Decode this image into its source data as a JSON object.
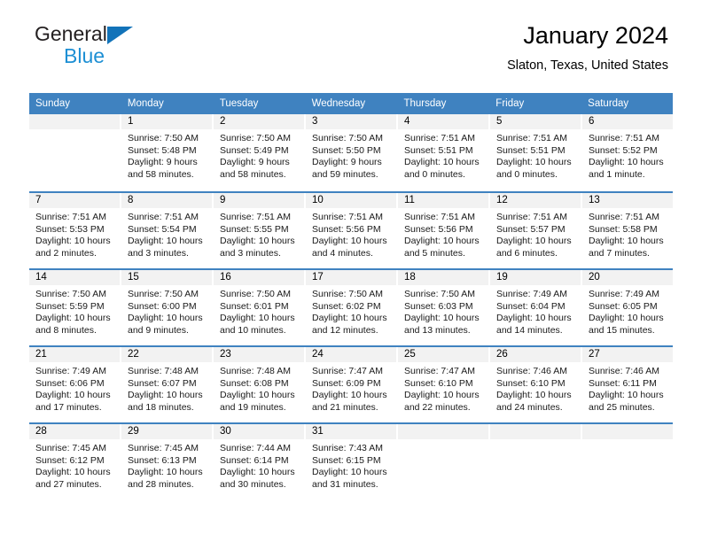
{
  "brand": {
    "name_dark": "General",
    "name_light": "Blue",
    "triangle_color": "#1273b9",
    "light_color": "#1d8fd4"
  },
  "header": {
    "title": "January 2024",
    "subtitle": "Slaton, Texas, United States"
  },
  "theme": {
    "header_row_bg": "#3f82c0",
    "day_number_bg": "#f2f2f2",
    "text_color": "#000000"
  },
  "calendar": {
    "weekday_headers": [
      "Sunday",
      "Monday",
      "Tuesday",
      "Wednesday",
      "Thursday",
      "Friday",
      "Saturday"
    ],
    "weeks": [
      [
        {
          "day": "",
          "lines": []
        },
        {
          "day": "1",
          "lines": [
            "Sunrise: 7:50 AM",
            "Sunset: 5:48 PM",
            "Daylight: 9 hours",
            "and 58 minutes."
          ]
        },
        {
          "day": "2",
          "lines": [
            "Sunrise: 7:50 AM",
            "Sunset: 5:49 PM",
            "Daylight: 9 hours",
            "and 58 minutes."
          ]
        },
        {
          "day": "3",
          "lines": [
            "Sunrise: 7:50 AM",
            "Sunset: 5:50 PM",
            "Daylight: 9 hours",
            "and 59 minutes."
          ]
        },
        {
          "day": "4",
          "lines": [
            "Sunrise: 7:51 AM",
            "Sunset: 5:51 PM",
            "Daylight: 10 hours",
            "and 0 minutes."
          ]
        },
        {
          "day": "5",
          "lines": [
            "Sunrise: 7:51 AM",
            "Sunset: 5:51 PM",
            "Daylight: 10 hours",
            "and 0 minutes."
          ]
        },
        {
          "day": "6",
          "lines": [
            "Sunrise: 7:51 AM",
            "Sunset: 5:52 PM",
            "Daylight: 10 hours",
            "and 1 minute."
          ]
        }
      ],
      [
        {
          "day": "7",
          "lines": [
            "Sunrise: 7:51 AM",
            "Sunset: 5:53 PM",
            "Daylight: 10 hours",
            "and 2 minutes."
          ]
        },
        {
          "day": "8",
          "lines": [
            "Sunrise: 7:51 AM",
            "Sunset: 5:54 PM",
            "Daylight: 10 hours",
            "and 3 minutes."
          ]
        },
        {
          "day": "9",
          "lines": [
            "Sunrise: 7:51 AM",
            "Sunset: 5:55 PM",
            "Daylight: 10 hours",
            "and 3 minutes."
          ]
        },
        {
          "day": "10",
          "lines": [
            "Sunrise: 7:51 AM",
            "Sunset: 5:56 PM",
            "Daylight: 10 hours",
            "and 4 minutes."
          ]
        },
        {
          "day": "11",
          "lines": [
            "Sunrise: 7:51 AM",
            "Sunset: 5:56 PM",
            "Daylight: 10 hours",
            "and 5 minutes."
          ]
        },
        {
          "day": "12",
          "lines": [
            "Sunrise: 7:51 AM",
            "Sunset: 5:57 PM",
            "Daylight: 10 hours",
            "and 6 minutes."
          ]
        },
        {
          "day": "13",
          "lines": [
            "Sunrise: 7:51 AM",
            "Sunset: 5:58 PM",
            "Daylight: 10 hours",
            "and 7 minutes."
          ]
        }
      ],
      [
        {
          "day": "14",
          "lines": [
            "Sunrise: 7:50 AM",
            "Sunset: 5:59 PM",
            "Daylight: 10 hours",
            "and 8 minutes."
          ]
        },
        {
          "day": "15",
          "lines": [
            "Sunrise: 7:50 AM",
            "Sunset: 6:00 PM",
            "Daylight: 10 hours",
            "and 9 minutes."
          ]
        },
        {
          "day": "16",
          "lines": [
            "Sunrise: 7:50 AM",
            "Sunset: 6:01 PM",
            "Daylight: 10 hours",
            "and 10 minutes."
          ]
        },
        {
          "day": "17",
          "lines": [
            "Sunrise: 7:50 AM",
            "Sunset: 6:02 PM",
            "Daylight: 10 hours",
            "and 12 minutes."
          ]
        },
        {
          "day": "18",
          "lines": [
            "Sunrise: 7:50 AM",
            "Sunset: 6:03 PM",
            "Daylight: 10 hours",
            "and 13 minutes."
          ]
        },
        {
          "day": "19",
          "lines": [
            "Sunrise: 7:49 AM",
            "Sunset: 6:04 PM",
            "Daylight: 10 hours",
            "and 14 minutes."
          ]
        },
        {
          "day": "20",
          "lines": [
            "Sunrise: 7:49 AM",
            "Sunset: 6:05 PM",
            "Daylight: 10 hours",
            "and 15 minutes."
          ]
        }
      ],
      [
        {
          "day": "21",
          "lines": [
            "Sunrise: 7:49 AM",
            "Sunset: 6:06 PM",
            "Daylight: 10 hours",
            "and 17 minutes."
          ]
        },
        {
          "day": "22",
          "lines": [
            "Sunrise: 7:48 AM",
            "Sunset: 6:07 PM",
            "Daylight: 10 hours",
            "and 18 minutes."
          ]
        },
        {
          "day": "23",
          "lines": [
            "Sunrise: 7:48 AM",
            "Sunset: 6:08 PM",
            "Daylight: 10 hours",
            "and 19 minutes."
          ]
        },
        {
          "day": "24",
          "lines": [
            "Sunrise: 7:47 AM",
            "Sunset: 6:09 PM",
            "Daylight: 10 hours",
            "and 21 minutes."
          ]
        },
        {
          "day": "25",
          "lines": [
            "Sunrise: 7:47 AM",
            "Sunset: 6:10 PM",
            "Daylight: 10 hours",
            "and 22 minutes."
          ]
        },
        {
          "day": "26",
          "lines": [
            "Sunrise: 7:46 AM",
            "Sunset: 6:10 PM",
            "Daylight: 10 hours",
            "and 24 minutes."
          ]
        },
        {
          "day": "27",
          "lines": [
            "Sunrise: 7:46 AM",
            "Sunset: 6:11 PM",
            "Daylight: 10 hours",
            "and 25 minutes."
          ]
        }
      ],
      [
        {
          "day": "28",
          "lines": [
            "Sunrise: 7:45 AM",
            "Sunset: 6:12 PM",
            "Daylight: 10 hours",
            "and 27 minutes."
          ]
        },
        {
          "day": "29",
          "lines": [
            "Sunrise: 7:45 AM",
            "Sunset: 6:13 PM",
            "Daylight: 10 hours",
            "and 28 minutes."
          ]
        },
        {
          "day": "30",
          "lines": [
            "Sunrise: 7:44 AM",
            "Sunset: 6:14 PM",
            "Daylight: 10 hours",
            "and 30 minutes."
          ]
        },
        {
          "day": "31",
          "lines": [
            "Sunrise: 7:43 AM",
            "Sunset: 6:15 PM",
            "Daylight: 10 hours",
            "and 31 minutes."
          ]
        },
        {
          "day": "",
          "lines": []
        },
        {
          "day": "",
          "lines": []
        },
        {
          "day": "",
          "lines": []
        }
      ]
    ]
  }
}
